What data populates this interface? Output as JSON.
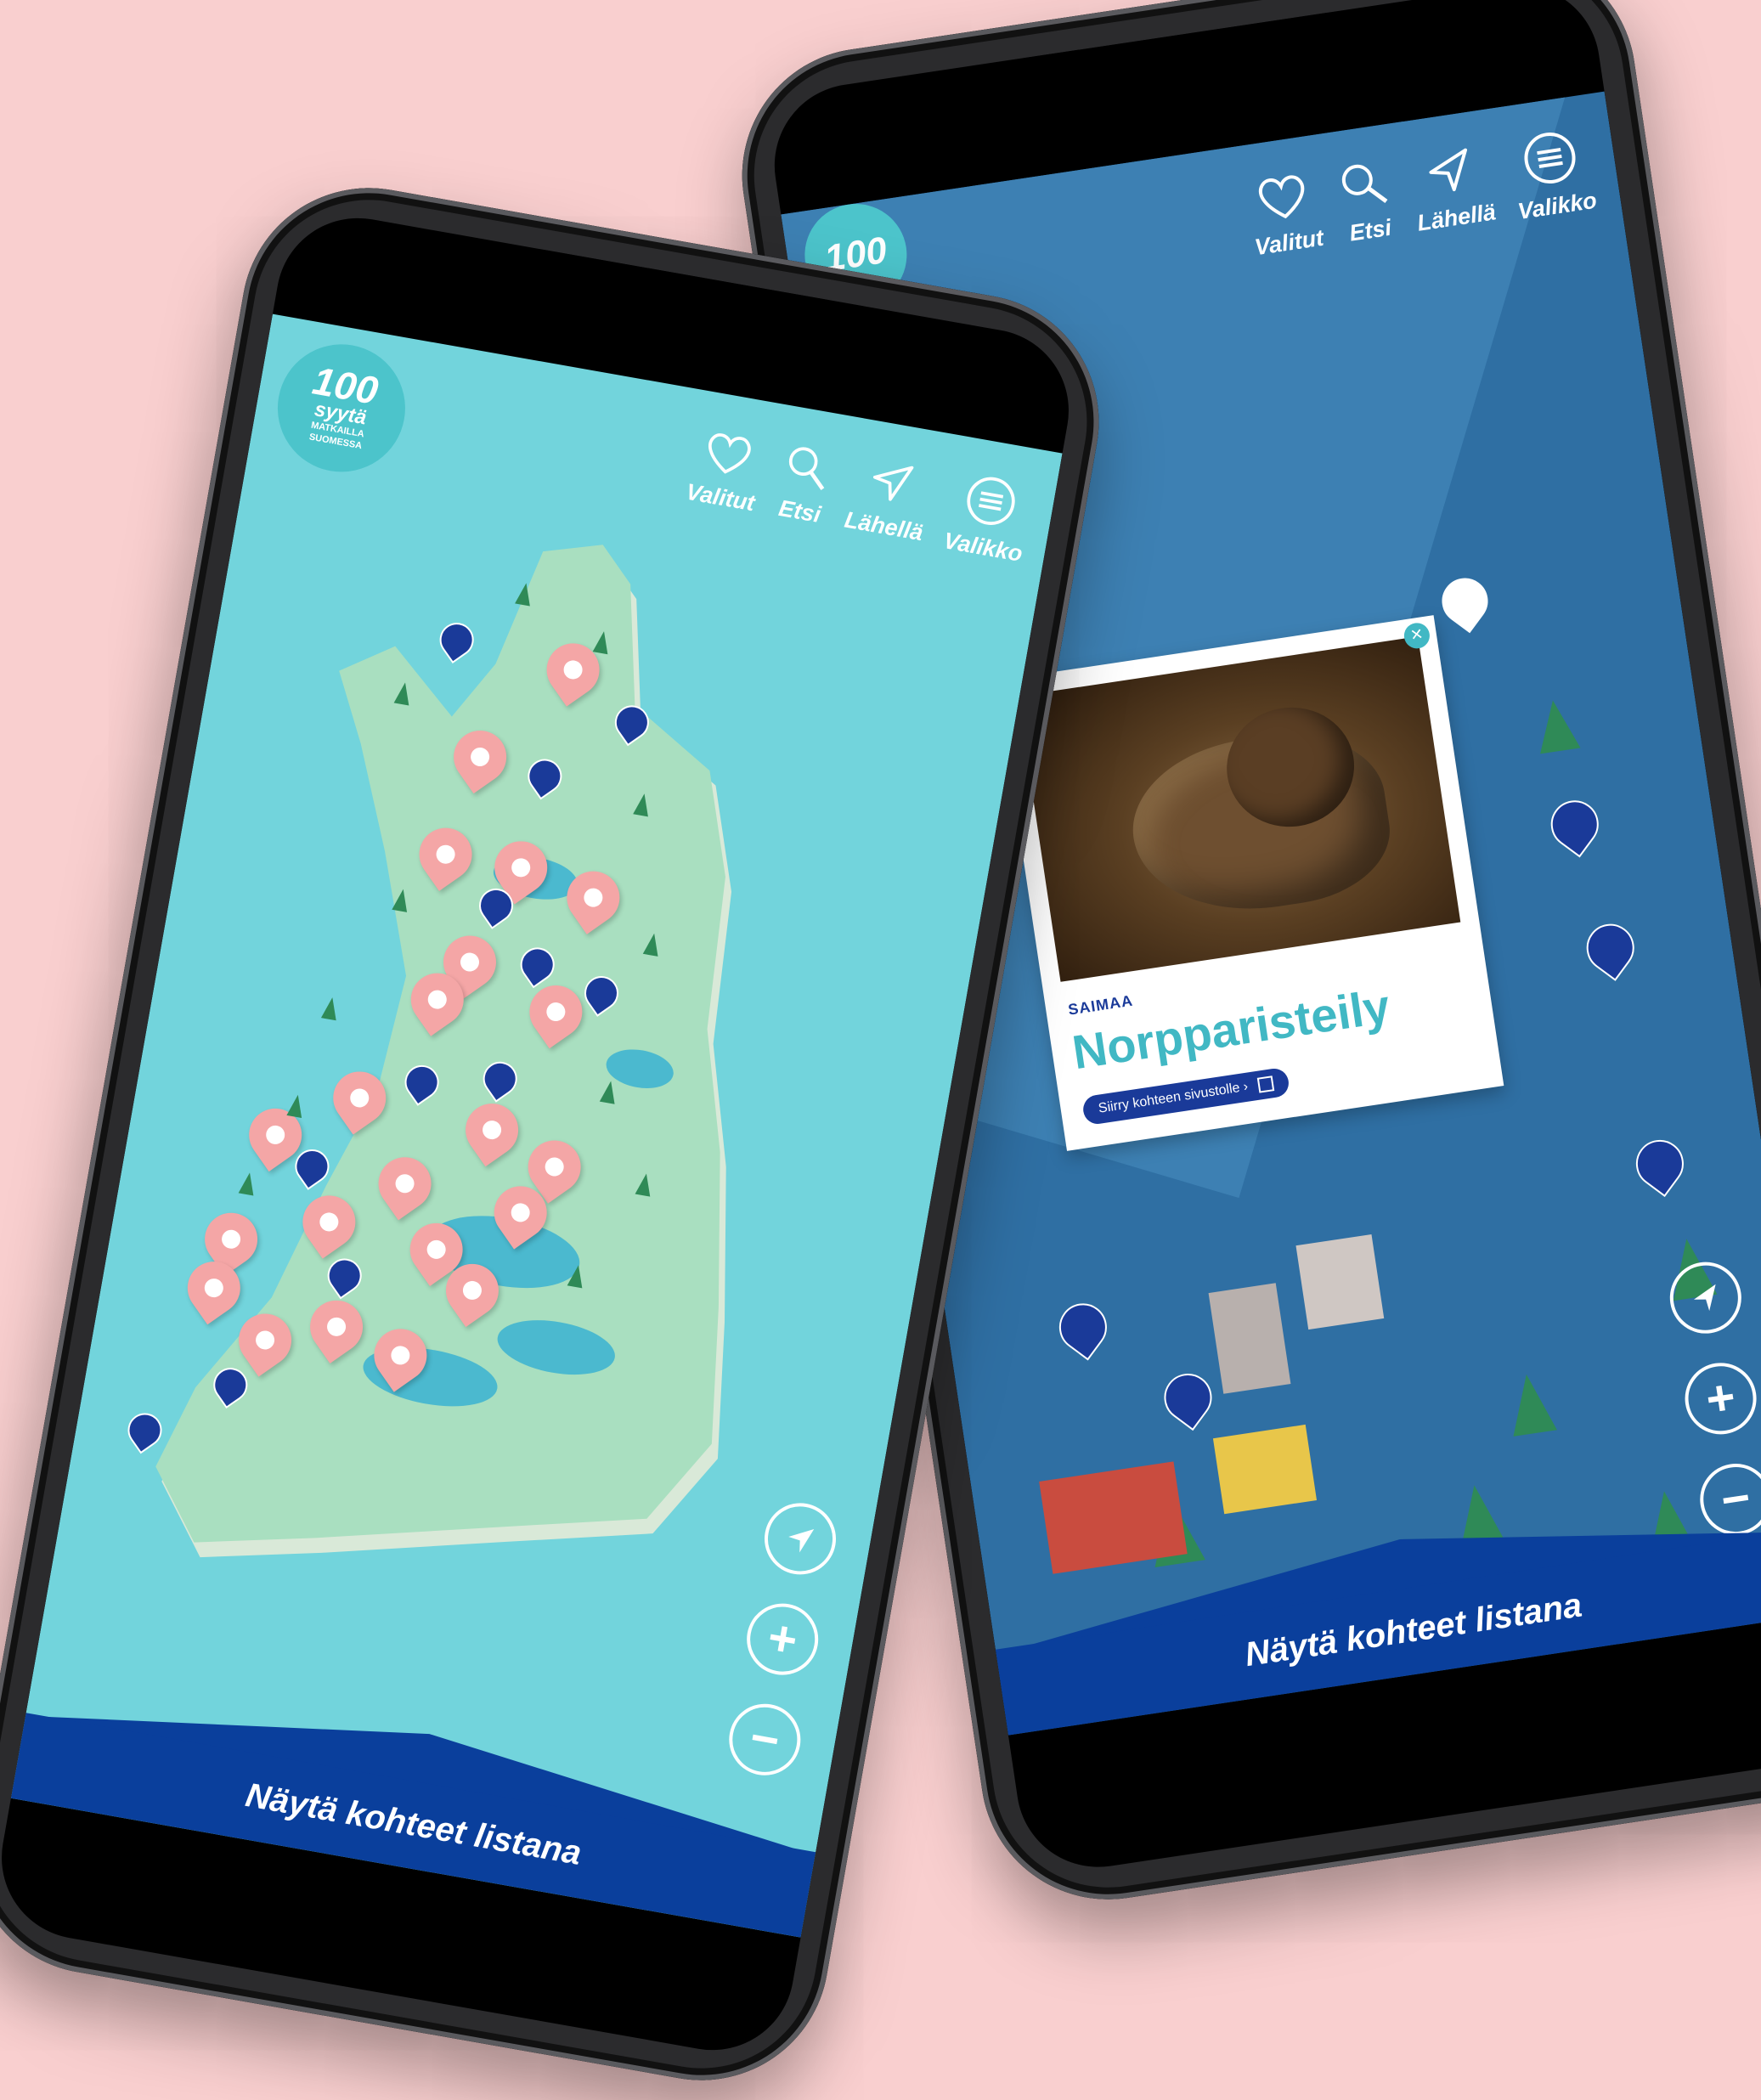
{
  "nav": {
    "favorites_label": "Valitut",
    "search_label": "Etsi",
    "nearby_label": "Lähellä",
    "menu_label": "Valikko"
  },
  "logo": {
    "number": "100",
    "word": "syytä",
    "line1": "MATKAILLA",
    "line2": "SUOMESSA"
  },
  "list_button_label": "Näytä kohteet listana",
  "map_controls": {
    "locate_icon": "locate-arrow-icon",
    "zoom_in_label": "+",
    "zoom_out_label": "−"
  },
  "popup": {
    "region": "SAIMAA",
    "title": "Norpparisteily",
    "link_label": "Siirry kohteen sivustolle ›",
    "close_label": "×",
    "image_subject": "Saimaa ringed seal photo"
  },
  "colors": {
    "background": "#f9cfcf",
    "map_water": "#72d4dc",
    "land": "#a9dfc0",
    "pin_pink": "#f4a6a6",
    "pin_blue": "#1a3a99",
    "bar_blue": "#0a3f9c",
    "zoomed_bg": "#2f6fa3",
    "popup_title": "#41b8c4"
  },
  "icons": [
    "heart-icon",
    "search-icon",
    "navigation-arrow-icon",
    "hamburger-menu-icon",
    "external-link-icon"
  ]
}
